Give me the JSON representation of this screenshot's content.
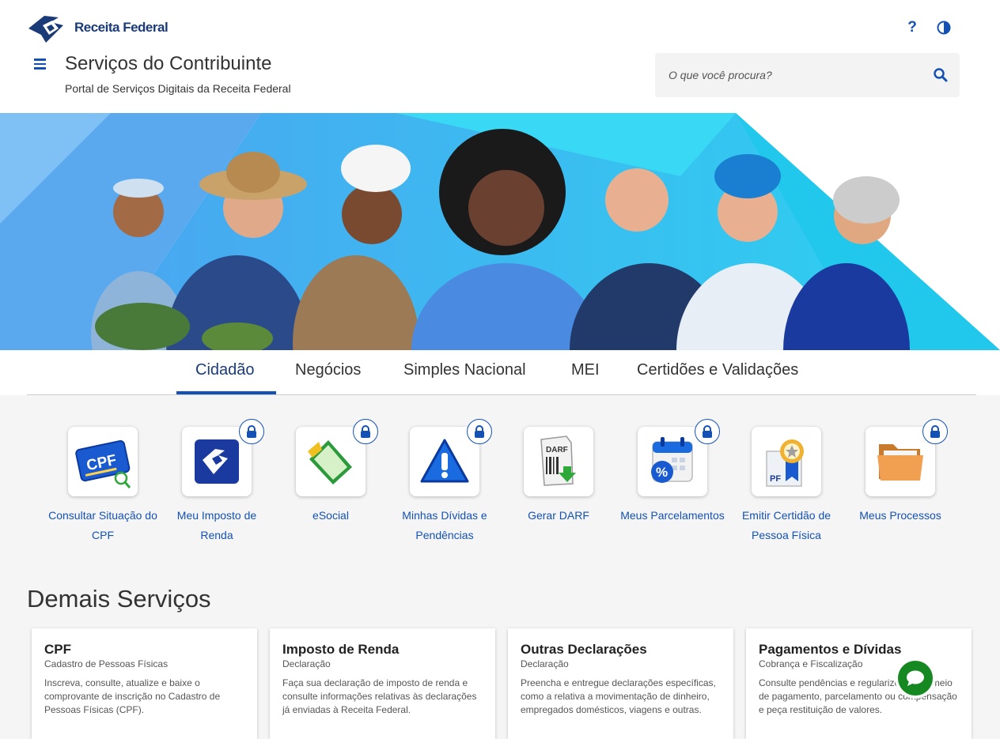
{
  "header": {
    "logo_text": "Receita Federal",
    "help_label": "?",
    "title": "Serviços do Contribuinte",
    "subtitle": "Portal de Serviços Digitais da Receita Federal",
    "search_placeholder": "O que você procura?"
  },
  "tabs": [
    {
      "label": "Cidadão",
      "active": true
    },
    {
      "label": "Negócios"
    },
    {
      "label": "Simples Nacional"
    },
    {
      "label": "MEI"
    },
    {
      "label": "Certidões e Validações"
    }
  ],
  "services": [
    {
      "label": "Consultar Situação do CPF",
      "icon": "cpf-card-icon",
      "locked": false
    },
    {
      "label": "Meu Imposto de Renda",
      "icon": "receita-logo-icon",
      "locked": true
    },
    {
      "label": "eSocial",
      "icon": "esocial-icon",
      "locked": true
    },
    {
      "label": "Minhas Dívidas e Pendências",
      "icon": "warning-icon",
      "locked": true
    },
    {
      "label": "Gerar DARF",
      "icon": "darf-document-icon",
      "locked": false
    },
    {
      "label": "Meus Parcelamentos",
      "icon": "calendar-percent-icon",
      "locked": true
    },
    {
      "label": "Emitir Certidão de Pessoa Física",
      "icon": "certificate-icon",
      "locked": false
    },
    {
      "label": "Meus Processos",
      "icon": "folder-icon",
      "locked": true
    }
  ],
  "other_services": {
    "title": "Demais Serviços",
    "cards": [
      {
        "title": "CPF",
        "subtitle": "Cadastro de Pessoas Físicas",
        "description": "Inscreva, consulte, atualize e baixe o comprovante de inscrição no Cadastro de Pessoas Físicas (CPF)."
      },
      {
        "title": "Imposto de Renda",
        "subtitle": "Declaração",
        "description": "Faça sua declaração de imposto de renda e consulte informações relativas às declarações já enviadas à Receita Federal."
      },
      {
        "title": "Outras Declarações",
        "subtitle": "Declaração",
        "description": "Preencha e entregue declarações específicas, como a relativa a movimentação de dinheiro, empregados domésticos, viagens e outras."
      },
      {
        "title": "Pagamentos e Dívidas",
        "subtitle": "Cobrança e Fiscalização",
        "description": "Consulte pendências e regularize-as por meio de pagamento, parcelamento ou compensação e peça restituição de valores."
      }
    ]
  },
  "colors": {
    "primary": "#1351b4",
    "brand": "#1a3a78",
    "chat": "#168821",
    "banner_cyan": "#2bd3f0"
  }
}
